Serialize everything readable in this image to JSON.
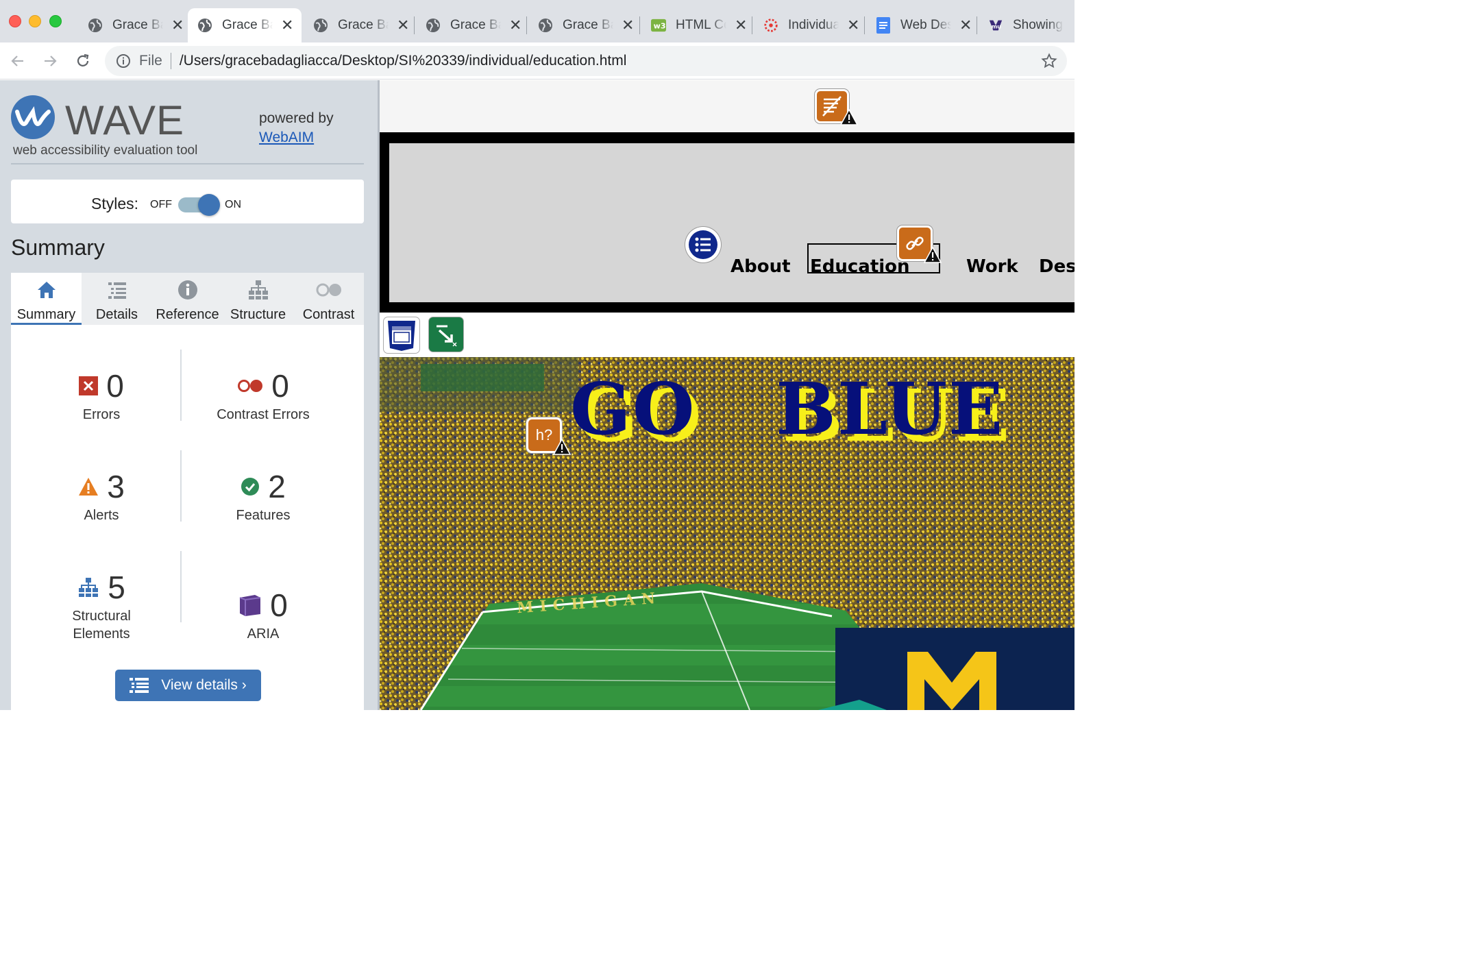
{
  "browser": {
    "tabs": [
      {
        "title": "Grace Badagliacca",
        "icon": "globe-icon",
        "active": false
      },
      {
        "title": "Grace Badagliacca",
        "icon": "globe-icon",
        "active": true
      },
      {
        "title": "Grace Badagliacca",
        "icon": "globe-icon",
        "active": false
      },
      {
        "title": "Grace Badagliacca",
        "icon": "globe-icon",
        "active": false
      },
      {
        "title": "Grace Badagliacca",
        "icon": "globe-icon",
        "active": false
      },
      {
        "title": "HTML Color Codes",
        "icon": "w3-icon",
        "active": false
      },
      {
        "title": "Individual",
        "icon": "canvas-icon",
        "active": false
      },
      {
        "title": "Web Design",
        "icon": "docs-icon",
        "active": false
      },
      {
        "title": "Showing",
        "icon": "umich-icon",
        "active": false
      }
    ],
    "address": {
      "scheme": "File",
      "url": "/Users/gracebadagliacca/Desktop/SI%20339/individual/education.html"
    }
  },
  "wave": {
    "title": "WAVE",
    "subtitle": "web accessibility evaluation tool",
    "powered_by": "powered by",
    "webaim_link": "WebAIM",
    "styles_label": "Styles:",
    "styles_off": "OFF",
    "styles_on": "ON",
    "styles_state": "on",
    "section_heading": "Summary",
    "tabs": [
      {
        "label": "Summary",
        "icon": "home-icon",
        "active": true
      },
      {
        "label": "Details",
        "icon": "list-icon",
        "active": false
      },
      {
        "label": "Reference",
        "icon": "info-icon",
        "active": false
      },
      {
        "label": "Structure",
        "icon": "hierarchy-icon",
        "active": false
      },
      {
        "label": "Contrast",
        "icon": "contrast-icon",
        "active": false
      }
    ],
    "stats": {
      "errors": {
        "count": "0",
        "label": "Errors",
        "color": "#c0392b"
      },
      "contrast_errors": {
        "count": "0",
        "label": "Contrast Errors",
        "color": "#c0392b"
      },
      "alerts": {
        "count": "3",
        "label": "Alerts",
        "color": "#e67e22"
      },
      "features": {
        "count": "2",
        "label": "Features",
        "color": "#2e8b57"
      },
      "structural": {
        "count": "5",
        "label_line1": "Structural",
        "label_line2": "Elements",
        "color": "#3e74b5"
      },
      "aria": {
        "count": "0",
        "label": "ARIA",
        "color": "#5b3a8c"
      }
    },
    "view_details": "View details ›"
  },
  "page": {
    "nav": [
      "About",
      "Education",
      "Work",
      "Design"
    ],
    "badge_heading_text": "h?",
    "headline_words": [
      "GO",
      "BLUE"
    ],
    "field_text": "MICHIGAN",
    "scoreboard_letter": "M"
  }
}
